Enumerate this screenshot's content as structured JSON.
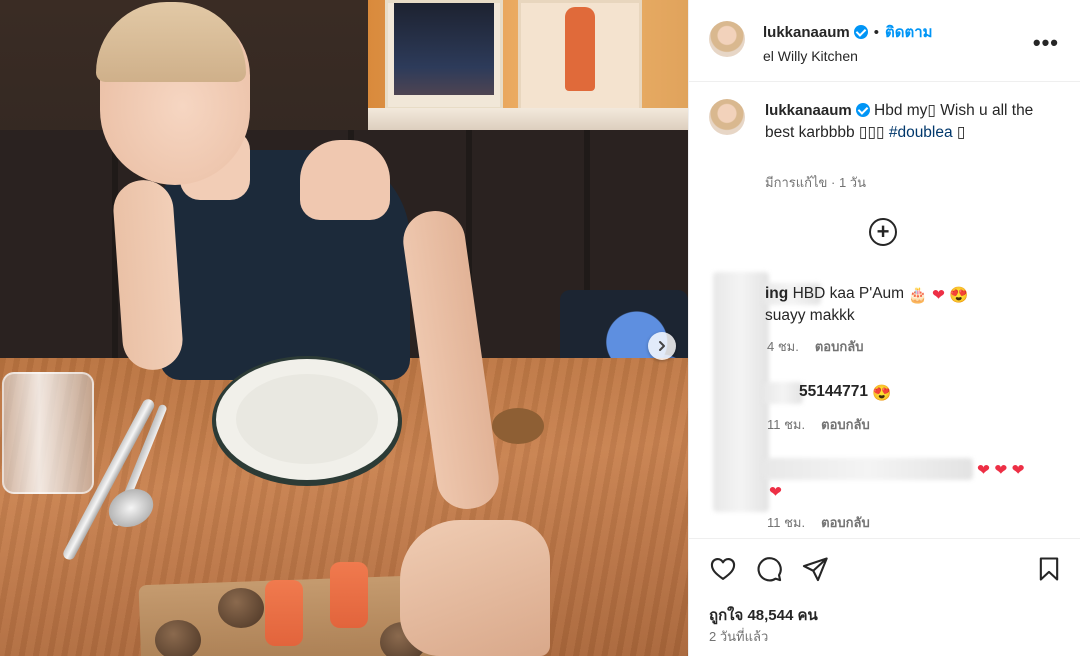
{
  "post": {
    "username": "lukkanaaum",
    "follow_label": "ติดตาม",
    "dot": "•",
    "location": "el Willy Kitchen",
    "more_icon": "more-horizontal-icon",
    "caption": {
      "username": "lukkanaaum",
      "text": "Hbd my▯ Wish u all the best karbbbb ▯▯▯ ",
      "hashtag": "#doublea",
      "trailing": " ▯",
      "meta": "มีการแก้ไข · 1 วัน"
    },
    "load_more_icon": "plus-circle-icon"
  },
  "comments": [
    {
      "username_visible": "ing",
      "text": "HBD kaa P'Aum",
      "emojis": [
        "🎂",
        "❤",
        "😍"
      ],
      "text2": "suayy makkk",
      "time": "4 ชม.",
      "reply_label": "ตอบกลับ"
    },
    {
      "username_visible": "55144771",
      "text": "",
      "emojis": [
        "😍"
      ],
      "time": "11 ชม.",
      "reply_label": "ตอบกลับ"
    },
    {
      "username_visible": "",
      "text": "",
      "emojis": [
        "❤",
        "❤",
        "❤",
        "❤"
      ],
      "time": "11 ชม.",
      "reply_label": "ตอบกลับ"
    }
  ],
  "actions": {
    "icons": [
      "heart-icon",
      "comment-icon",
      "share-icon",
      "bookmark-icon"
    ],
    "likes": "ถูกใจ 48,544 คน",
    "posted_ago": "2 วันที่แล้ว"
  },
  "colors": {
    "accent": "#0095f6",
    "hashtag": "#00376b",
    "muted": "#737373",
    "heart": "#ed2f45"
  }
}
